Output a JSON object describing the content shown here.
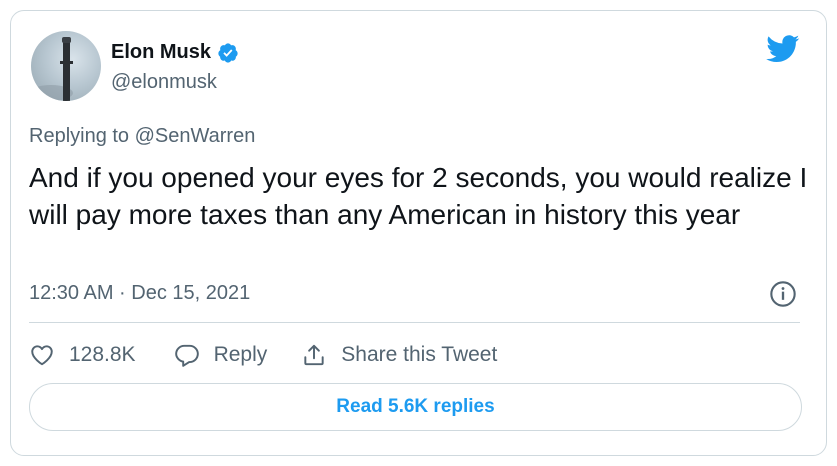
{
  "author": {
    "name": "Elon Musk",
    "handle": "@elonmusk"
  },
  "reply_context": {
    "prefix": "Replying to",
    "mention": "@SenWarren"
  },
  "tweet": {
    "text": "And if you opened your eyes for 2 seconds, you would realize I will pay more taxes than any American in history this year",
    "timestamp": "12:30 AM · Dec 15, 2021"
  },
  "actions": {
    "like_count": "128.8K",
    "reply_label": "Reply",
    "share_label": "Share this Tweet"
  },
  "read_replies_label": "Read 5.6K replies",
  "icons": [
    "twitter-bird-icon",
    "verified-badge-icon",
    "info-icon",
    "heart-icon",
    "reply-bubble-icon",
    "share-icon"
  ],
  "colors": {
    "accent": "#1d9bf0",
    "secondary_text": "#536471",
    "border": "#cfd9de"
  }
}
